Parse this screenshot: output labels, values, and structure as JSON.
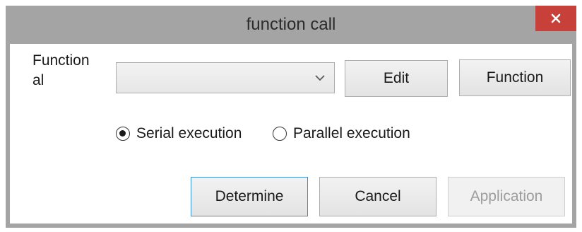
{
  "window": {
    "title": "function call",
    "close_icon": "close-icon"
  },
  "form": {
    "function_label_line1": "Function",
    "function_label_line2": "al",
    "function_select": {
      "selected_value": ""
    },
    "edit_button": "Edit",
    "function_button": "Function"
  },
  "execution_mode": {
    "options": [
      {
        "label": "Serial execution",
        "checked": true
      },
      {
        "label": "Parallel execution",
        "checked": false
      }
    ]
  },
  "footer": {
    "determine_button": "Determine",
    "cancel_button": "Cancel",
    "application_button": "Application"
  },
  "colors": {
    "close_button_bg": "#c7403a",
    "frame": "#a4a4a4",
    "default_button_border": "#3c8fd6"
  }
}
